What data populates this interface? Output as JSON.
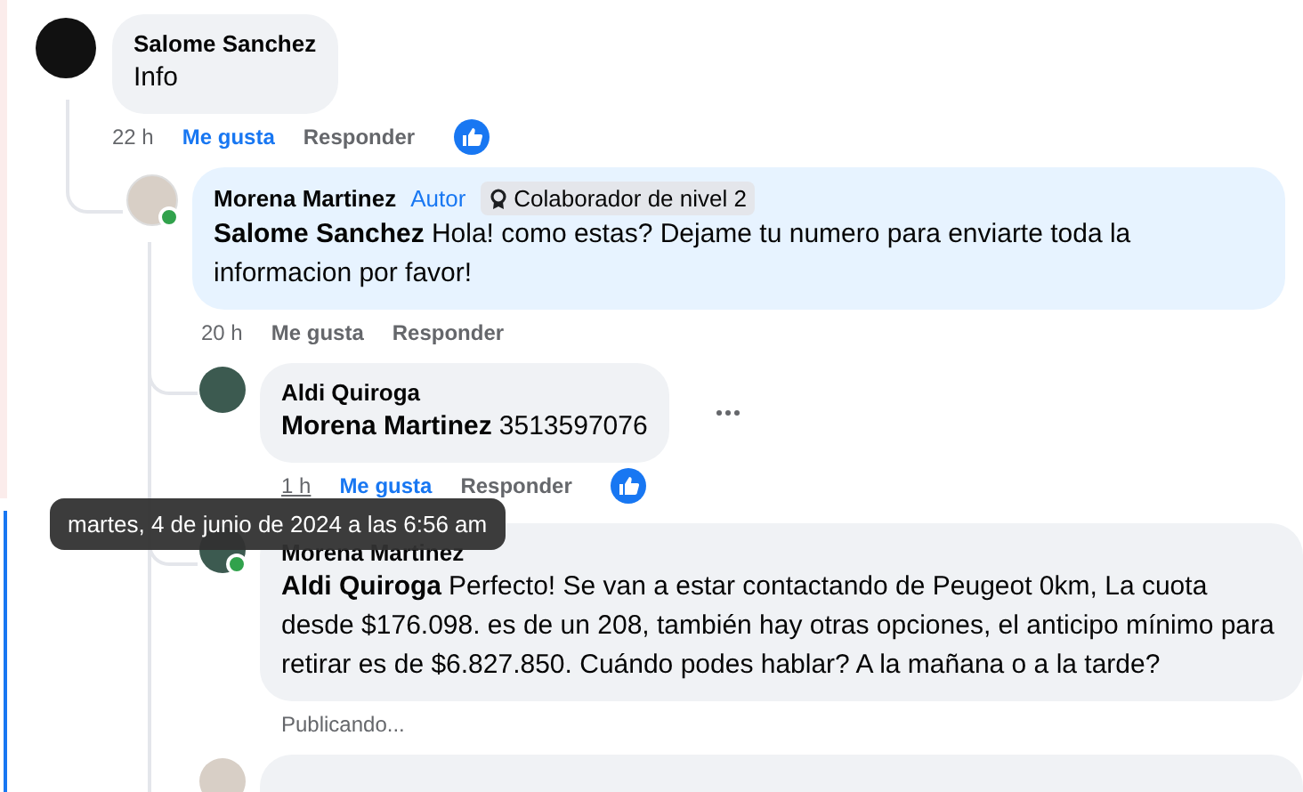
{
  "comments": [
    {
      "author": "Salome Sanchez",
      "text": "Info",
      "time": "22 h",
      "time_hovered": false,
      "like": "Me gusta",
      "liked": true,
      "reply": "Responder",
      "reaction": true,
      "children": [
        {
          "author": "Morena Martinez",
          "badges": [
            {
              "kind": "role",
              "label": "Autor"
            },
            {
              "kind": "level",
              "label": "Colaborador de nivel 2"
            }
          ],
          "mention": "Salome Sanchez",
          "text": "Hola! como estas? Dejame tu numero para enviarte toda la informacion por favor!",
          "time": "20 h",
          "time_hovered": false,
          "like": "Me gusta",
          "liked": false,
          "reply": "Responder",
          "online": true,
          "children": [
            {
              "author": "Aldi Quiroga",
              "mention": "Morena Martinez",
              "text": "3513597076",
              "time": "1 h",
              "time_hovered": true,
              "like": "Me gusta",
              "liked": true,
              "reply": "Responder",
              "reaction": true,
              "more": true
            },
            {
              "author": "Morena Martinez",
              "mention": "Aldi Quiroga",
              "text": "Perfecto! Se van a estar contactando de Peugeot 0km, La cuota desde $176.098. es de un 208, también hay otras opciones, el anticipo mínimo para retirar es de $6.827.850. Cuándo podes hablar? A la mañana o a la tarde?",
              "online": true,
              "status": "Publicando..."
            }
          ]
        }
      ]
    }
  ],
  "tooltip": {
    "text": "martes, 4 de junio de 2024 a las 6:56 am"
  }
}
